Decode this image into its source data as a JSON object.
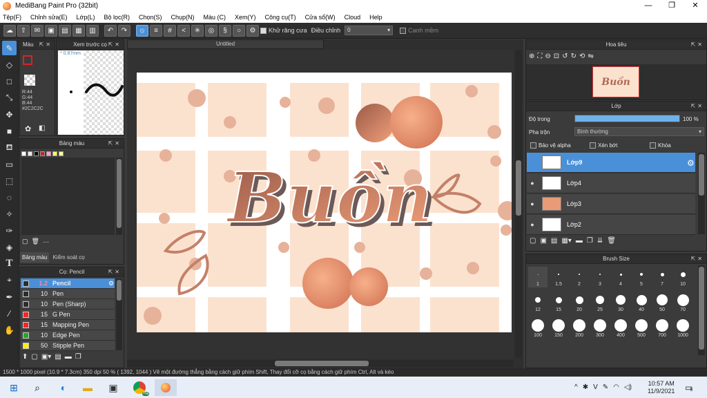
{
  "window": {
    "title": "MediBang Paint Pro (32bit)",
    "controls": [
      "—",
      "❐",
      "✕"
    ]
  },
  "menu": [
    "Tệp(F)",
    "Chỉnh sửa(E)",
    "Lớp(L)",
    "Bộ lọc(R)",
    "Chọn(S)",
    "Chụp(N)",
    "Màu (C)",
    "Xem(Y)",
    "Công cụ(T)",
    "Cửa sổ(W)",
    "Cloud",
    "Help"
  ],
  "toolbar": {
    "antialias_label": "Khử răng cưa",
    "correction_label": "Điều chỉnh",
    "correction_value": "0",
    "snap_label": "Canh mềm"
  },
  "color_panel": {
    "title": "Màu",
    "r": "R:44",
    "g": "G:44",
    "b": "B:44",
    "hex": "#2C2C2C",
    "current_color": "#2c2c2c"
  },
  "preview_panel": {
    "title": "Xem trước cọ",
    "size": "* 0.87mm"
  },
  "palette_panel": {
    "title": "Bảng màu",
    "swatches": [
      "#ffffff",
      "#e8e8e8",
      "#000000",
      "#cc2222",
      "#ff9ad5",
      "#ffff66",
      "#ffff99"
    ],
    "tab1": "Bảng màu",
    "tab2": "Kiểm soát cọ",
    "dash": "---"
  },
  "brush_panel": {
    "title": "Cọ: Pencil",
    "brushes": [
      {
        "size": "1.2",
        "name": "Pencil",
        "color": "#2c2c2c"
      },
      {
        "size": "10",
        "name": "Pen",
        "color": "#2c2c2c"
      },
      {
        "size": "10",
        "name": "Pen (Sharp)",
        "color": "#2c2c2c"
      },
      {
        "size": "15",
        "name": "G Pen",
        "color": "#ff2222"
      },
      {
        "size": "15",
        "name": "Mapping Pen",
        "color": "#ff2222"
      },
      {
        "size": "10",
        "name": "Edge Pen",
        "color": "#22aa22"
      },
      {
        "size": "50",
        "name": "Stipple Pen",
        "color": "#ffee00"
      }
    ]
  },
  "document": {
    "title": "Untitled",
    "lettering": "Buồn"
  },
  "navigator": {
    "title": "Hoa tiêu"
  },
  "layer_panel": {
    "title": "Lớp",
    "opacity_label": "Độ trong",
    "opacity_value": "100 %",
    "opacity_fraction": 1.0,
    "blend_label": "Pha trộn",
    "blend_value": "Bình thường",
    "protect_alpha": "Bảo vệ alpha",
    "clipping": "Xén bớt",
    "lock": "Khóa",
    "layers": [
      {
        "name": "Lớp9",
        "selected": true,
        "visible": false
      },
      {
        "name": "Lớp4",
        "selected": false,
        "visible": true
      },
      {
        "name": "Lớp3",
        "selected": false,
        "visible": true
      },
      {
        "name": "Lớp2",
        "selected": false,
        "visible": true
      }
    ]
  },
  "brush_size_panel": {
    "title": "Brush Size",
    "sizes": [
      "1",
      "1.5",
      "2",
      "3",
      "4",
      "5",
      "7",
      "10",
      "12",
      "15",
      "20",
      "25",
      "30",
      "40",
      "50",
      "70",
      "100",
      "150",
      "200",
      "300",
      "400",
      "500",
      "700",
      "1000"
    ]
  },
  "status": {
    "text": "1500 * 1000 pixel  (10.9 * 7.3cm)  350 dpi  50 %  ( 1392, 1044 )  Vẽ một đường thẳng bằng cách giữ phím Shift, Thay đổi cỡ cọ bằng cách giữ phím Ctrl, Alt và kéo"
  },
  "taskbar": {
    "time": "10:57 AM",
    "date": "11/9/2021",
    "notification_count": "5",
    "chrome_badge": "Hà"
  }
}
